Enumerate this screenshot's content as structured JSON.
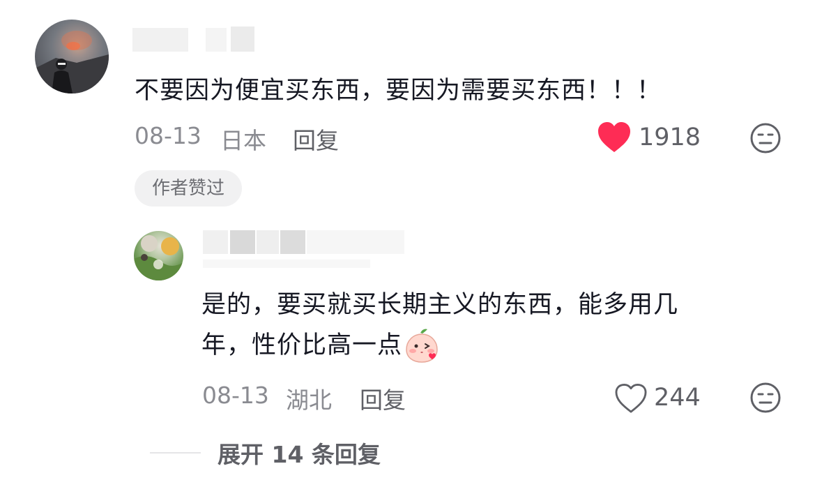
{
  "comments": [
    {
      "text": "不要因为便宜买东西，要因为需要买东西！！！",
      "date": "08-13",
      "location": "日本",
      "reply_label": "回复",
      "likes": "1918",
      "liked": true,
      "like_color": "#fe2c55",
      "badge": "作者赞过"
    }
  ],
  "reply": {
    "text_line1": "是的，要买就买长期主义的东西，能多用几",
    "text_line2": "年，性价比高一点",
    "date": "08-13",
    "location": "湖北",
    "reply_label": "回复",
    "likes": "244",
    "liked": false
  },
  "expand": {
    "label": "展开 14 条回复"
  },
  "icons": {
    "like_filled": "heart-filled-icon",
    "like_outline": "heart-outline-icon",
    "dislike": "meh-face-icon",
    "emoji": "blushing-peach-emoji-icon"
  }
}
